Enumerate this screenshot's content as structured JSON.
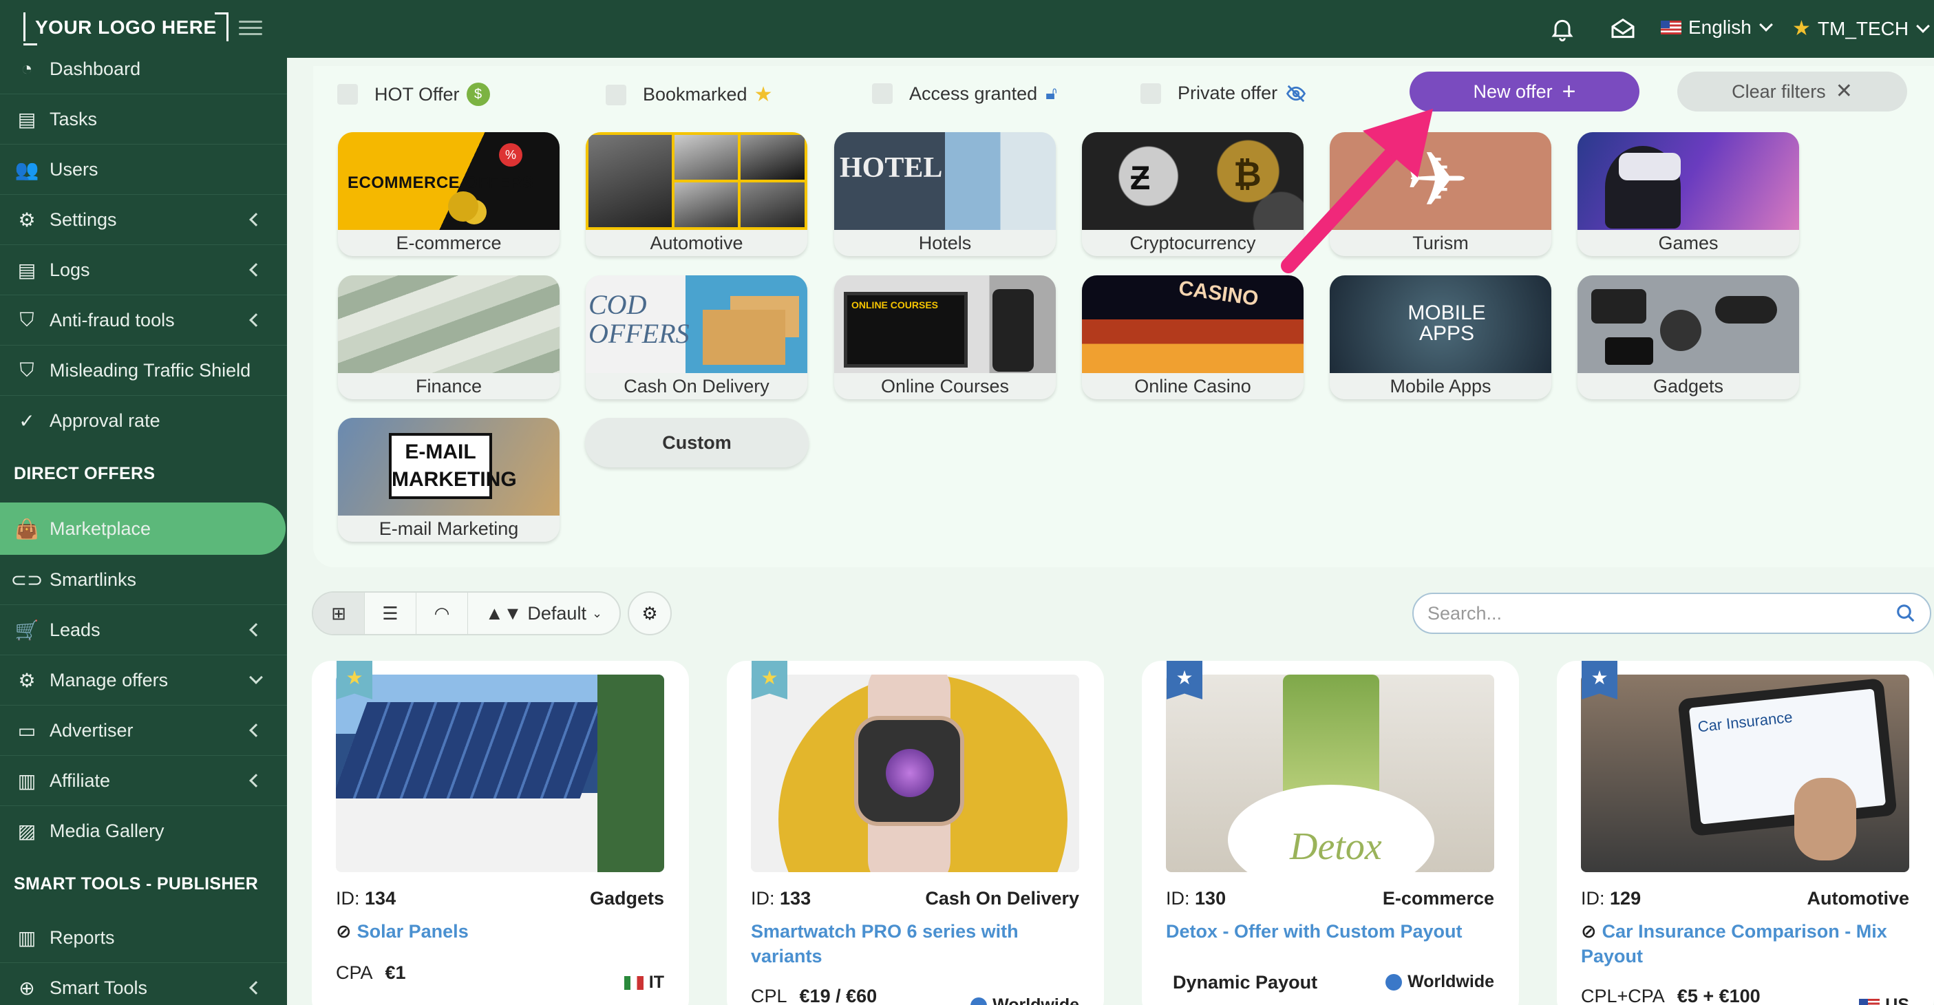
{
  "header": {
    "logo": "YOUR LOGO HERE",
    "language": "English",
    "username": "TM_TECH"
  },
  "sidebar": {
    "items": [
      {
        "label": "Dashboard"
      },
      {
        "label": "Tasks"
      },
      {
        "label": "Users"
      },
      {
        "label": "Settings"
      },
      {
        "label": "Logs"
      },
      {
        "label": "Anti-fraud tools"
      },
      {
        "label": "Misleading Traffic Shield"
      },
      {
        "label": "Approval rate"
      },
      {
        "label": "Marketplace"
      },
      {
        "label": "Smartlinks"
      },
      {
        "label": "Leads"
      },
      {
        "label": "Manage offers"
      },
      {
        "label": "Advertiser"
      },
      {
        "label": "Affiliate"
      },
      {
        "label": "Media Gallery"
      },
      {
        "label": "Reports"
      },
      {
        "label": "Smart Tools"
      }
    ],
    "sections": [
      "DIRECT OFFERS",
      "SMART TOOLS - PUBLISHER"
    ]
  },
  "filters": {
    "hot_offer": "HOT Offer",
    "bookmarked": "Bookmarked",
    "access_granted": "Access granted",
    "private_offer": "Private offer",
    "new_offer": "New offer",
    "clear_filters": "Clear filters"
  },
  "categories": [
    {
      "label": "E-commerce",
      "banner": "ECOMMERCE OFFERS"
    },
    {
      "label": "Automotive"
    },
    {
      "label": "Hotels",
      "banner": "HOTEL"
    },
    {
      "label": "Cryptocurrency"
    },
    {
      "label": "Turism"
    },
    {
      "label": "Games"
    },
    {
      "label": "Finance"
    },
    {
      "label": "Cash On Delivery",
      "banner": "COD OFFERS"
    },
    {
      "label": "Online Courses",
      "banner": "ONLINE COURSES"
    },
    {
      "label": "Online Casino",
      "banner": "CASINO"
    },
    {
      "label": "Mobile Apps",
      "banner": "MOBILE APPS"
    },
    {
      "label": "Gadgets"
    },
    {
      "label": "E-mail Marketing",
      "banner": "E-MAIL MARKETING"
    },
    {
      "label": "Custom"
    }
  ],
  "toolbar": {
    "sort": "Default",
    "search_placeholder": "Search..."
  },
  "offers": [
    {
      "id_label": "ID:",
      "id": "134",
      "category": "Gadgets",
      "title": "Solar Panels",
      "type": "CPA",
      "payout": "€1",
      "geo": "IT"
    },
    {
      "id_label": "ID:",
      "id": "133",
      "category": "Cash On Delivery",
      "title": "Smartwatch PRO 6 series with variants",
      "type": "CPL",
      "payout": "€19 / €60",
      "geo": "Worldwide"
    },
    {
      "id_label": "ID:",
      "id": "130",
      "category": "E-commerce",
      "title": "Detox - Offer with Custom Payout",
      "type": "Dynamic Payout",
      "payout": "",
      "geo": "Worldwide",
      "image_text": "Detox"
    },
    {
      "id_label": "ID:",
      "id": "129",
      "category": "Automotive",
      "title": "Car Insurance Comparison - Mix Payout",
      "type": "CPL+CPA",
      "payout": "€5 + €100",
      "geo": "US",
      "image_text": "Car Insurance"
    }
  ],
  "colors": {
    "sidebar_bg": "#1f4a37",
    "active_item": "#5cb87a",
    "new_offer": "#7a4bbf",
    "link_blue": "#4a90d0",
    "arrow": "#f0287a"
  }
}
